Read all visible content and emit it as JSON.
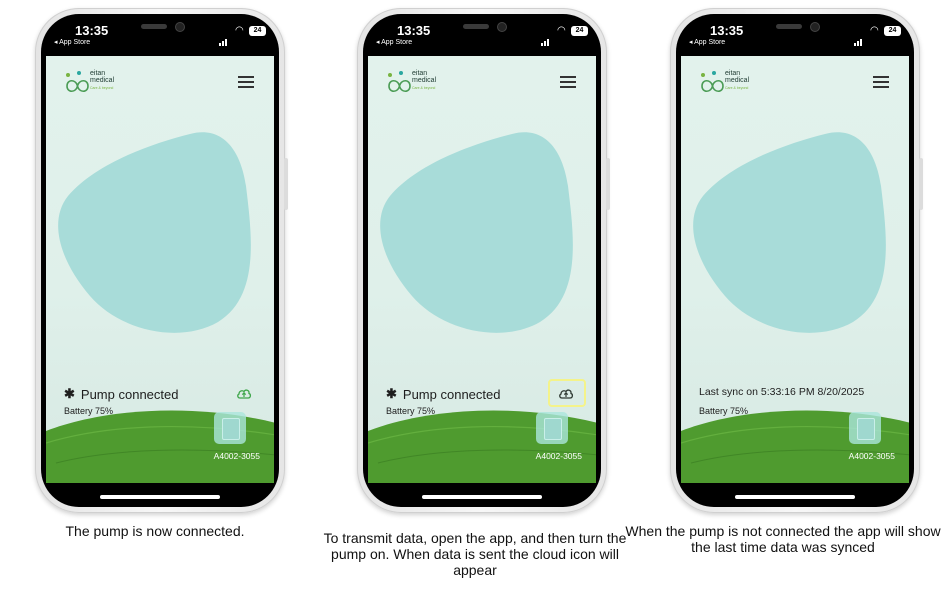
{
  "colors": {
    "app_bg": "#dff0ea",
    "blob": "#a8dcd9",
    "hill": "#4f9b2f",
    "cloud_icon": "#3ea64a",
    "highlight_box": "#f4f38a"
  },
  "panels": [
    {
      "status_bar": {
        "time": "13:35",
        "back_link": "◂ App Store",
        "battery": "24"
      },
      "logo": {
        "name": "eitan",
        "sub": "medical",
        "tag": "Care & beyond"
      },
      "status_text": "Pump connected",
      "battery_text": "Battery 75%",
      "serial": "A4002-3055",
      "caption": "The pump is now connected."
    },
    {
      "status_bar": {
        "time": "13:35",
        "back_link": "◂ App Store",
        "battery": "24"
      },
      "logo": {
        "name": "eitan",
        "sub": "medical",
        "tag": "Care & beyond"
      },
      "status_text": "Pump connected",
      "battery_text": "Battery 75%",
      "serial": "A4002-3055",
      "caption": "To transmit data, open the app, and then turn the pump on. When data is sent the cloud icon will appear"
    },
    {
      "status_bar": {
        "time": "13:35",
        "back_link": "◂ App Store",
        "battery": "24"
      },
      "logo": {
        "name": "eitan",
        "sub": "medical",
        "tag": "Care & beyond"
      },
      "status_text": "Last sync on 5:33:16 PM 8/20/2025",
      "battery_text": "Battery 75%",
      "serial": "A4002-3055",
      "caption": "When the pump is not connected the app will show the last time data was synced"
    }
  ]
}
